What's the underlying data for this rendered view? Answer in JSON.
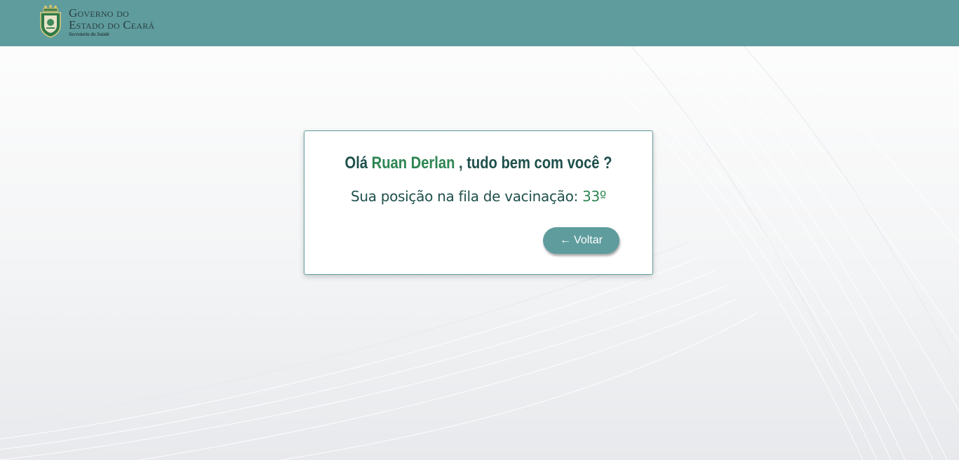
{
  "header": {
    "logo": {
      "line1": "Governo do",
      "line2": "Estado do Ceará",
      "line3": "Secretaria da Saúde"
    },
    "background_color": "#5f9c9e"
  },
  "card": {
    "greeting_prefix": "Olá ",
    "user_name": "Ruan Derlan",
    "greeting_suffix": " , tudo bem com você ?",
    "position_label": "Sua posição na fila de vacinação: ",
    "position_value": "33º",
    "back_button": {
      "icon": "left-arrow-icon",
      "arrow": "←",
      "label": "Voltar"
    }
  },
  "colors": {
    "accent": "#5f9c9e",
    "name_green": "#2e8552",
    "text_dark": "#1e4f4b"
  }
}
